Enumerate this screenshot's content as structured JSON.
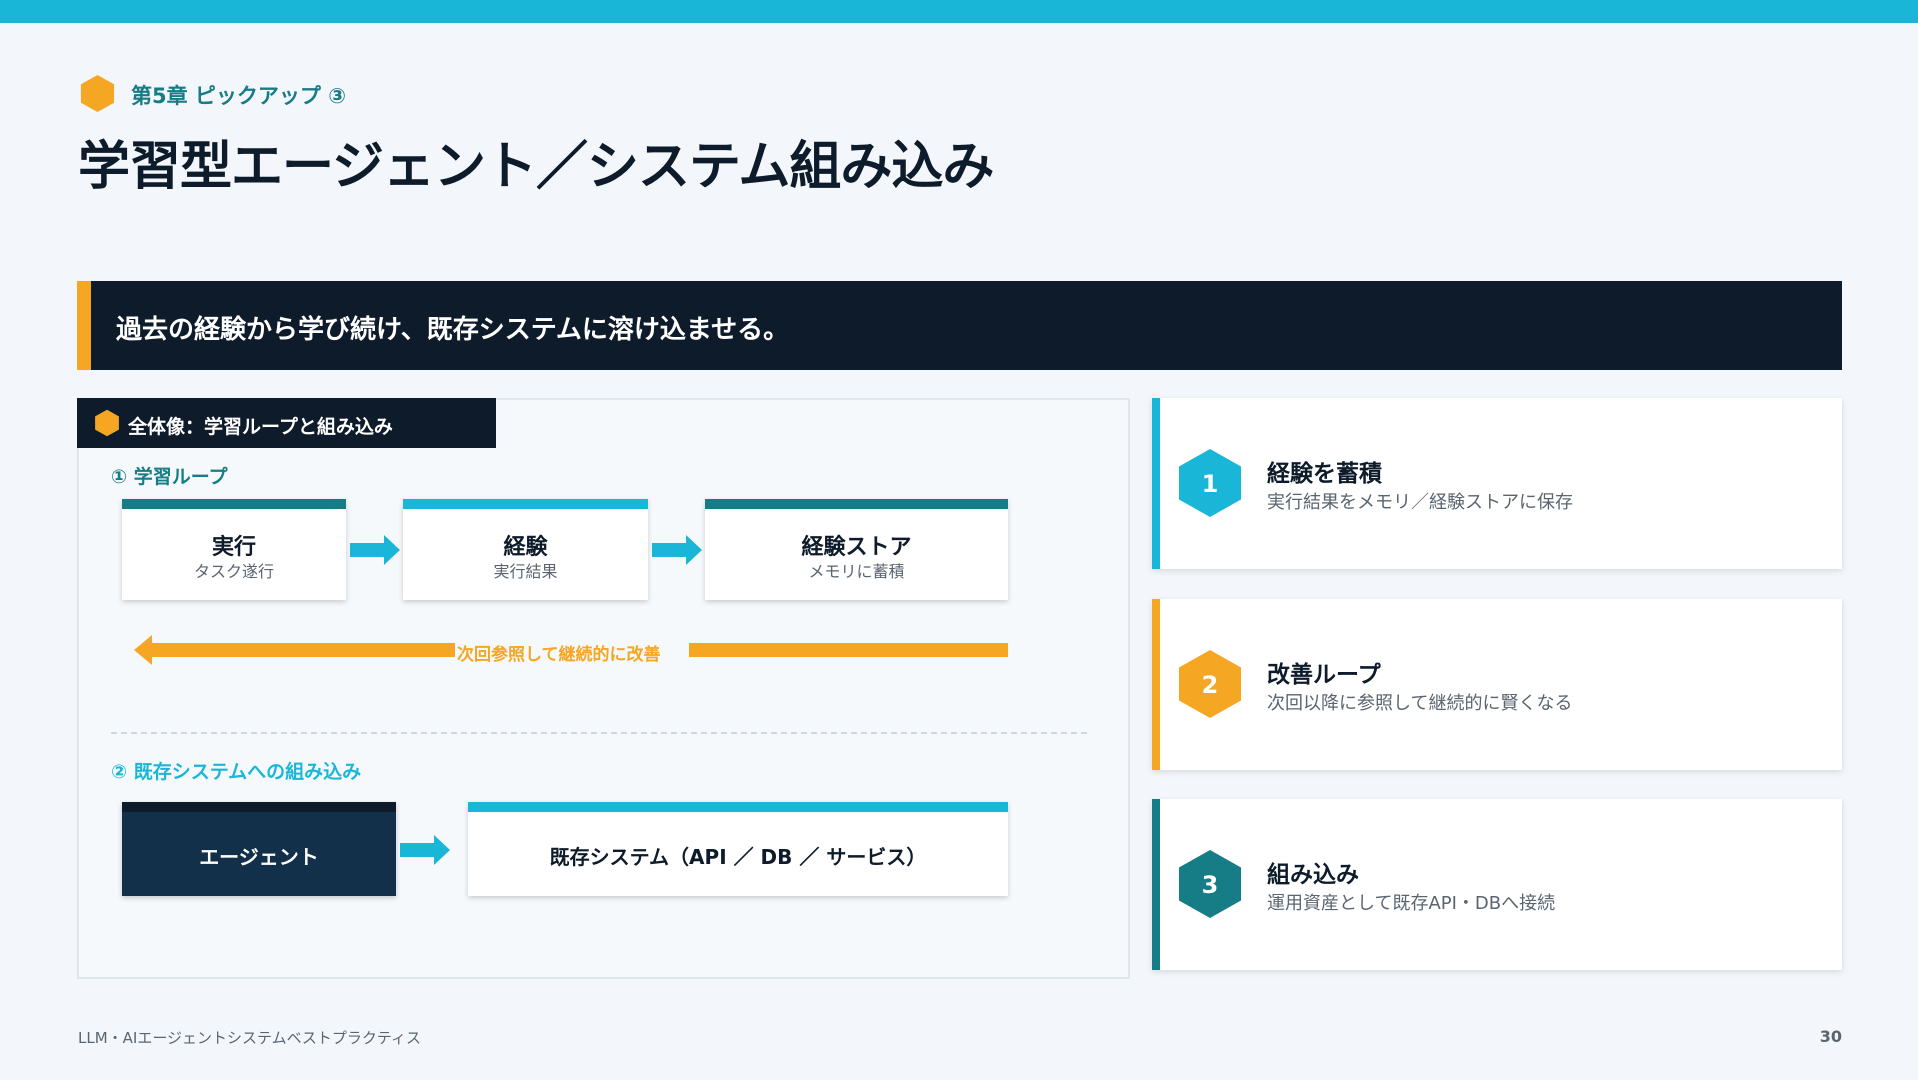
{
  "header": {
    "chapter_label": "第5章 ピックアップ ③",
    "title": "学習型エージェント／システム組み込み",
    "accent_color": "#f5a623",
    "brand_color": "#1ab6d8"
  },
  "banner": {
    "text": "過去の経験から学び続け、既存システムに溶け込ませる。"
  },
  "diagram": {
    "header": "全体像：学習ループと組み込み",
    "section1_label": "① 学習ループ",
    "loop_steps": [
      {
        "title": "実行",
        "subtitle": "タスク遂行"
      },
      {
        "title": "経験",
        "subtitle": "実行結果"
      },
      {
        "title": "経験ストア",
        "subtitle": "メモリに蓄積"
      }
    ],
    "loop_back_label": "次回参照して継続的に改善",
    "section2_label": "② 既存システムへの組み込み",
    "agent_label": "エージェント",
    "system_label": "既存システム（API ／ DB ／ サービス）"
  },
  "cards": [
    {
      "number": "1",
      "title": "経験を蓄積",
      "description": "実行結果をメモリ／経験ストアに保存",
      "color": "#1ab6d8"
    },
    {
      "number": "2",
      "title": "改善ループ",
      "description": "次回以降に参照して継続的に賢くなる",
      "color": "#f5a623"
    },
    {
      "number": "3",
      "title": "組み込み",
      "description": "運用資産として既存API・DBへ接続",
      "color": "#167c86"
    }
  ],
  "footer": {
    "left": "LLM・AIエージェントシステムベストプラクティス",
    "page_number": "30"
  }
}
